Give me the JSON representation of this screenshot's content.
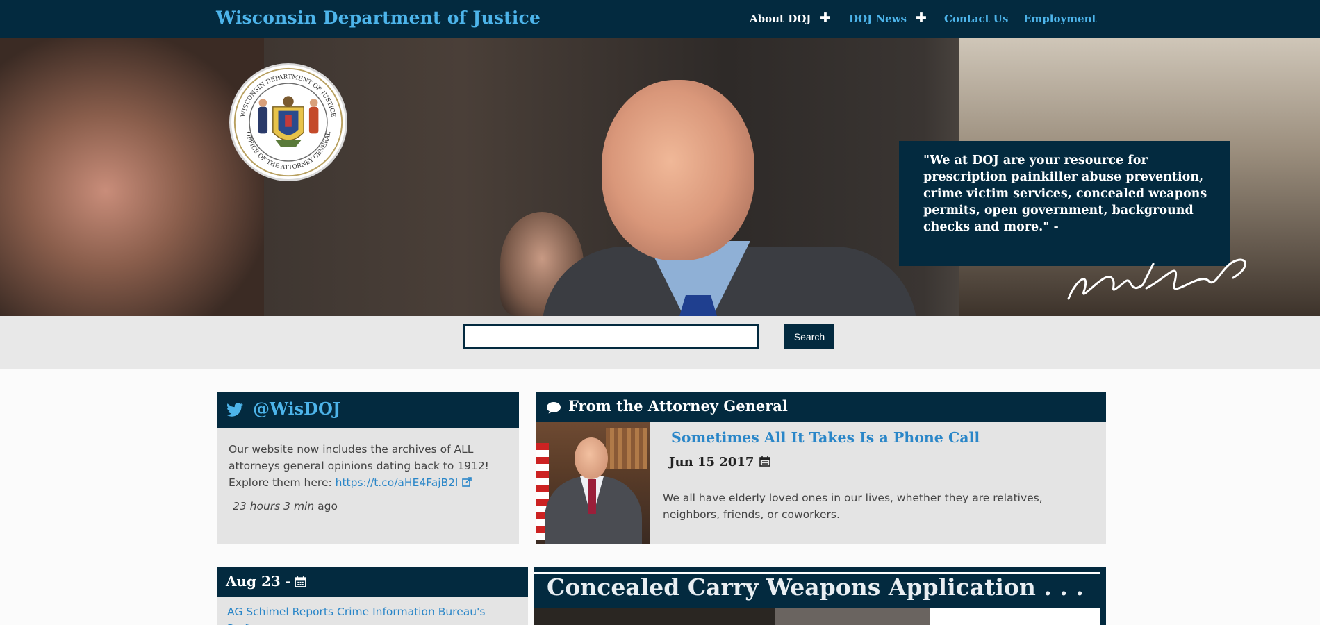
{
  "header": {
    "site_title": "Wisconsin Department of Justice",
    "nav": [
      {
        "label": "About DOJ",
        "has_submenu": true
      },
      {
        "label": "DOJ News",
        "has_submenu": true
      },
      {
        "label": "Contact Us",
        "has_submenu": false
      },
      {
        "label": "Employment",
        "has_submenu": false
      }
    ],
    "submenu_icon": "plus-icon"
  },
  "hero": {
    "seal_text": "WISCONSIN DEPARTMENT OF JUSTICE · OFFICE OF THE ATTORNEY GENERAL",
    "quote": "\"We at DOJ are your resource for prescription painkiller abuse prevention, crime victim services, concealed weapons permits, open government, background checks and more.\" -",
    "signature": "Brad Schimel"
  },
  "search": {
    "input_value": "",
    "button_label": "Search"
  },
  "twitter": {
    "icon": "twitter-icon",
    "handle": "@WisDOJ",
    "tweet_text": "Our website now includes the archives of ALL attorneys general opinions dating back to 1912! Explore them here: ",
    "tweet_link": "https://t.co/aHE4FajB2l",
    "time_italic": "23 hours 3 min",
    "time_suffix": " ago"
  },
  "ag_panel": {
    "icon": "speech-bubble-icon",
    "heading": "From the Attorney General",
    "article_title": "Sometimes All It Takes Is a Phone Call",
    "article_date": "Jun 15 2017",
    "excerpt": "We all have elderly loved ones in our lives, whether they are relatives, neighbors, friends, or coworkers."
  },
  "news": {
    "date": "Aug 23 -",
    "headline": "AG Schimel Reports Crime Information Bureau's Performance"
  },
  "feature": {
    "title": "Concealed Carry Weapons Application . . ."
  },
  "colors": {
    "navy": "#032a3f",
    "link_blue": "#2a86c8",
    "title_blue": "#4db4ea",
    "panel_gray": "#e4e4e4"
  }
}
